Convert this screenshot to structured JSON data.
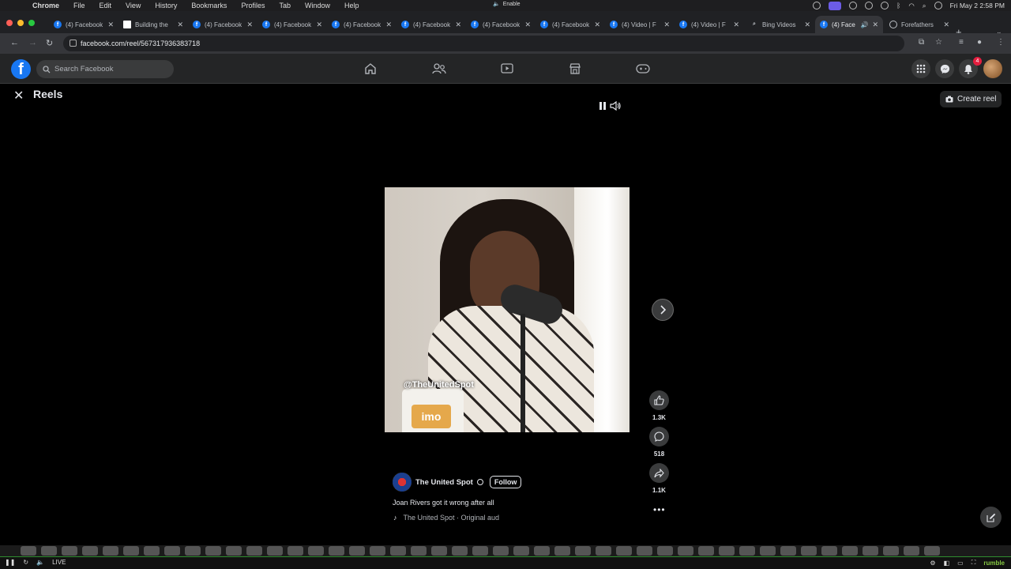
{
  "mac_menu": {
    "app": "Chrome",
    "items": [
      "File",
      "Edit",
      "View",
      "History",
      "Bookmarks",
      "Profiles",
      "Tab",
      "Window",
      "Help"
    ],
    "center_label": "Enable",
    "datetime": "Fri May 2  2:58 PM"
  },
  "tabs": [
    {
      "title": "(4) Facebook",
      "icon": "facebook-icon"
    },
    {
      "title": "Building the",
      "icon": "doc-icon"
    },
    {
      "title": "(4) Facebook",
      "icon": "facebook-icon"
    },
    {
      "title": "(4) Facebook",
      "icon": "facebook-icon"
    },
    {
      "title": "(4) Facebook",
      "icon": "facebook-icon"
    },
    {
      "title": "(4) Facebook",
      "icon": "facebook-icon"
    },
    {
      "title": "(4) Facebook",
      "icon": "facebook-icon"
    },
    {
      "title": "(4) Facebook",
      "icon": "facebook-icon"
    },
    {
      "title": "(4) Video | F",
      "icon": "facebook-icon"
    },
    {
      "title": "(4) Video | F",
      "icon": "facebook-icon"
    },
    {
      "title": "Bing Videos",
      "icon": "search-icon"
    },
    {
      "title": "(4) Face",
      "icon": "facebook-icon",
      "active": true
    },
    {
      "title": "Forefathers",
      "icon": "globe-icon"
    }
  ],
  "address_bar": {
    "url": "facebook.com/reel/567317936383718"
  },
  "facebook": {
    "search_placeholder": "Search Facebook",
    "notification_count": "4"
  },
  "reels": {
    "title": "Reels",
    "create_label": "Create reel",
    "watermark": "@TheUnitedSpot",
    "mug_text": "imo",
    "likes": "1.3K",
    "comments": "518",
    "shares": "1.1K",
    "author": "The United Spot",
    "follow_label": "Follow",
    "caption": "Joan Rivers got it wrong after all",
    "audio": "The United Spot · Original aud"
  },
  "rumble_bar": {
    "live_label": "LIVE",
    "brand": "rumble"
  },
  "colors": {
    "facebook_blue": "#1877f2",
    "badge_red": "#e41e3f",
    "rumble_green": "#85c742"
  }
}
